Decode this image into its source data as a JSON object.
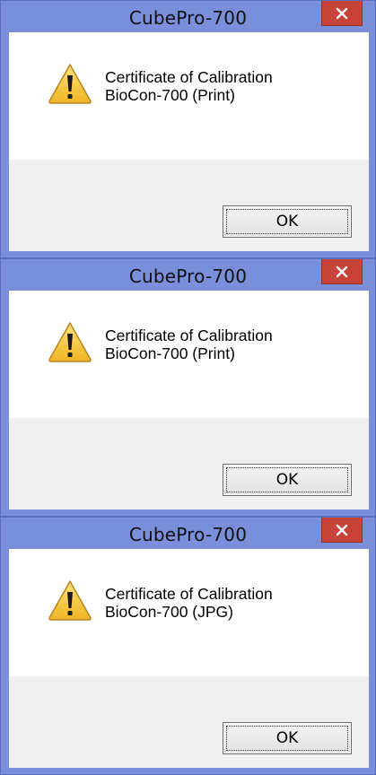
{
  "dialogs": [
    {
      "title": "CubePro-700",
      "icon": "warning-icon",
      "message_line1": "Certificate of Calibration",
      "message_line2": "BioCon-700 (Print)",
      "ok_label": "OK"
    },
    {
      "title": "CubePro-700",
      "icon": "warning-icon",
      "message_line1": "Certificate of Calibration",
      "message_line2": "BioCon-700 (Print)",
      "ok_label": "OK"
    },
    {
      "title": "CubePro-700",
      "icon": "warning-icon",
      "message_line1": "Certificate of Calibration",
      "message_line2": "BioCon-700 (JPG)",
      "ok_label": "OK"
    }
  ],
  "colors": {
    "frame": "#7a8fd9",
    "close_button": "#c7433a",
    "content_bg": "#ffffff",
    "footer_bg": "#f0f0f0"
  }
}
